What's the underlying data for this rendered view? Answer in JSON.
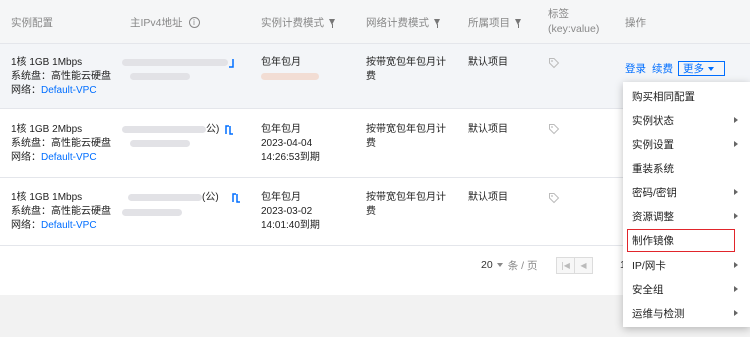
{
  "columns": {
    "config": "实例配置",
    "ipv4": "主IPv4地址",
    "billing": "实例计费模式",
    "netbilling": "网络计费模式",
    "project": "所属项目",
    "tag_line1": "标签",
    "tag_line2": "(key:value)",
    "ops": "操作"
  },
  "rows": [
    {
      "config1": "1核 1GB 1Mbps",
      "config2": "系统盘：高性能云硬盘",
      "network_label": "网络：",
      "network_link": "Default-VPC",
      "ip_suffix": "",
      "billing": "包年包月",
      "billing_date": "",
      "billing_time": "",
      "netbilling1": "按带宽包年包月计",
      "netbilling2": "费",
      "project": "默认项目"
    },
    {
      "config1": "1核 1GB 2Mbps",
      "config2": "系统盘：高性能云硬盘",
      "network_label": "网络：",
      "network_link": "Default-VPC",
      "ip_suffix": "公)",
      "billing": "包年包月",
      "billing_date": "2023-04-04",
      "billing_time": "14:26:53到期",
      "netbilling1": "按带宽包年包月计",
      "netbilling2": "费",
      "project": "默认项目"
    },
    {
      "config1": "1核 1GB 1Mbps",
      "config2": "系统盘：高性能云硬盘",
      "network_label": "网络：",
      "network_link": "Default-VPC",
      "ip_suffix": "(公)",
      "billing": "包年包月",
      "billing_date": "2023-03-02",
      "billing_time": "14:01:40到期",
      "netbilling1": "按带宽包年包月计",
      "netbilling2": "费",
      "project": "默认项目"
    }
  ],
  "actions": {
    "login": "登录",
    "renew": "续费",
    "more": "更多"
  },
  "menu": [
    {
      "label": "购买相同配置",
      "submenu": false
    },
    {
      "label": "实例状态",
      "submenu": true
    },
    {
      "label": "实例设置",
      "submenu": true
    },
    {
      "label": "重装系统",
      "submenu": false
    },
    {
      "label": "密码/密钥",
      "submenu": true
    },
    {
      "label": "资源调整",
      "submenu": true
    },
    {
      "label": "制作镜像",
      "submenu": false,
      "highlighted": true
    },
    {
      "label": "IP/网卡",
      "submenu": true
    },
    {
      "label": "安全组",
      "submenu": true
    },
    {
      "label": "运维与检测",
      "submenu": true
    }
  ],
  "pagination": {
    "page_size": "20",
    "per_page_suffix": "条 / 页",
    "current_page": "1",
    "first_icon": "first-page-icon",
    "prev_icon": "prev-page-icon"
  },
  "colors": {
    "link": "#006eff",
    "highlight_border": "#e1252b"
  }
}
